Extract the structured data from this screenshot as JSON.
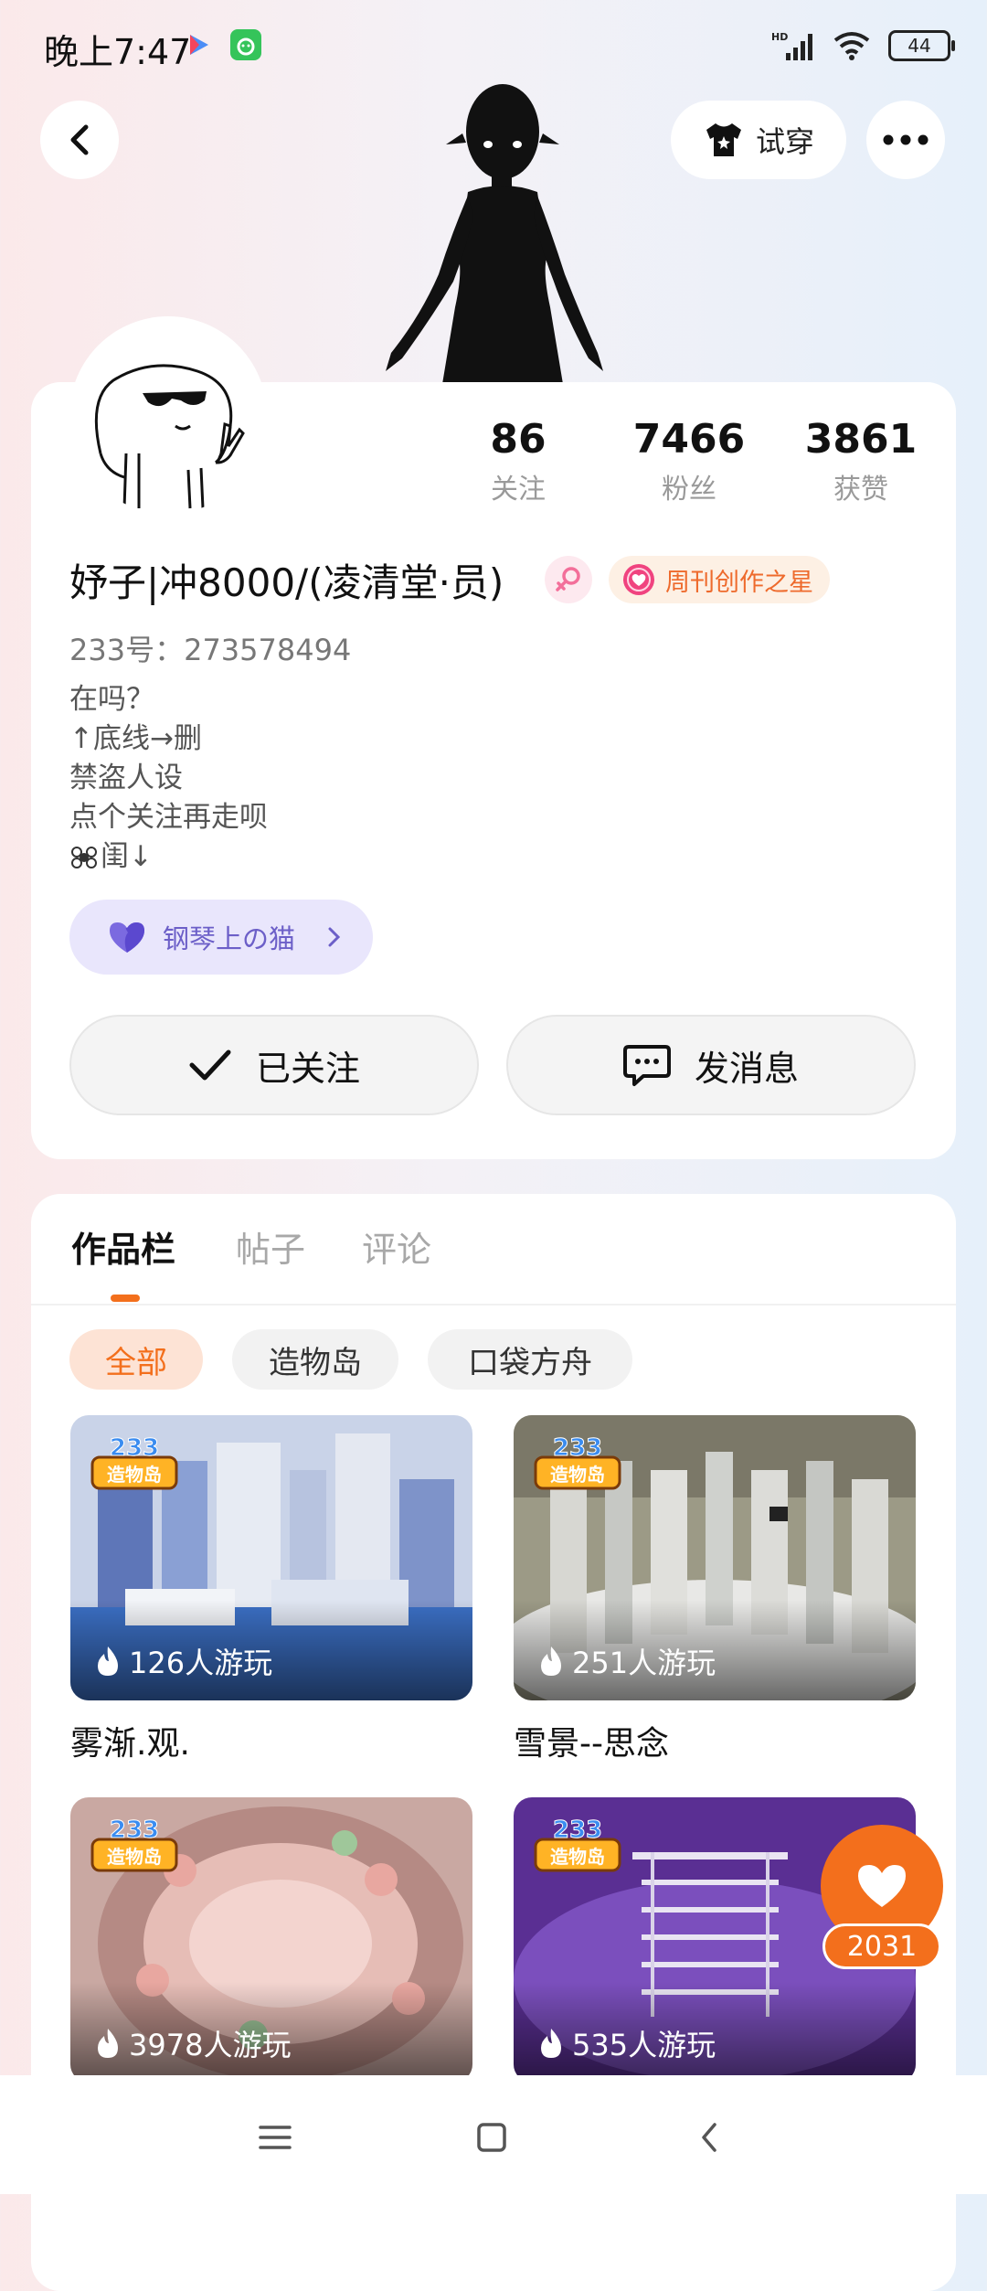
{
  "status_bar": {
    "time": "晚上7:47",
    "battery": "44",
    "icons": [
      "play-icon",
      "app-icon",
      "hd-signal-icon",
      "wifi-icon",
      "battery-icon"
    ]
  },
  "top_bar": {
    "tryon_label": "试穿",
    "icons": [
      "back-icon",
      "tshirt-icon",
      "more-icon"
    ]
  },
  "profile": {
    "stats": [
      {
        "value": "86",
        "label": "关注"
      },
      {
        "value": "7466",
        "label": "粉丝"
      },
      {
        "value": "3861",
        "label": "获赞"
      }
    ],
    "username": "妤子|冲8000/(凌清堂·员)",
    "badge_label": "周刊创作之星",
    "account_id": "233号：273578494",
    "bio_lines": [
      "在吗？",
      "↑底线→删",
      "禁盗人设",
      "点个关注再走呗",
      "闺↓"
    ],
    "linked_friend": "钢琴上の猫",
    "follow_label": "已关注",
    "message_label": "发消息",
    "colors": {
      "accent": "#f36f1c",
      "badge_text": "#ee6a2c",
      "friend_pill": "#e9e6fc"
    }
  },
  "works": {
    "tabs": [
      "作品栏",
      "帖子",
      "评论"
    ],
    "filters": [
      "全部",
      "造物岛",
      "口袋方舟"
    ],
    "items": [
      {
        "players": "126人游玩",
        "title": "雾渐.观."
      },
      {
        "players": "251人游玩",
        "title": "雪景--思念"
      },
      {
        "players": "3978人游玩",
        "title": ""
      },
      {
        "players": "535人游玩",
        "title": ""
      }
    ],
    "logo_text": [
      "233",
      "造物岛"
    ]
  },
  "like": {
    "count": "2031"
  }
}
